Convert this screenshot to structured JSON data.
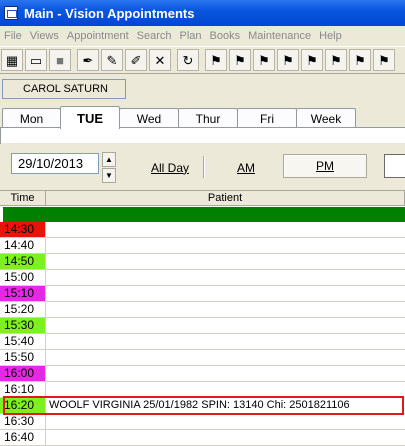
{
  "window": {
    "title": "Main - Vision Appointments"
  },
  "menu": [
    "File",
    "Views",
    "Appointment",
    "Search",
    "Plan",
    "Books",
    "Maintenance",
    "Help"
  ],
  "toolbar": {
    "icons": [
      "calendar-grid-icon",
      "calendar-icon",
      "gray-block-icon",
      "pen-icon",
      "pencil-icon",
      "pencil-x-icon",
      "delete-x-icon",
      "refresh-icon",
      "flag-1-icon",
      "flag-2-icon",
      "flag-3-icon",
      "flag-4-icon",
      "flag-5-icon",
      "flag-6-icon",
      "flag-7-icon",
      "flag-8-icon"
    ]
  },
  "user": {
    "name": "CAROL SATURN"
  },
  "tabs": [
    {
      "label": "Mon"
    },
    {
      "label": "TUE",
      "active": true
    },
    {
      "label": "Wed"
    },
    {
      "label": "Thur"
    },
    {
      "label": "Fri"
    },
    {
      "label": "Week"
    }
  ],
  "controls": {
    "date": "29/10/2013",
    "all_day": "All Day",
    "am": "AM",
    "pm": "PM"
  },
  "grid": {
    "headers": {
      "time": "Time",
      "patient": "Patient"
    },
    "session_bar_color": "#008000",
    "rows": [
      {
        "time": "14:30",
        "color": "#e8140a",
        "patient": ""
      },
      {
        "time": "14:40",
        "color": "",
        "patient": ""
      },
      {
        "time": "14:50",
        "color": "#7ef01e",
        "patient": ""
      },
      {
        "time": "15:00",
        "color": "",
        "patient": ""
      },
      {
        "time": "15:10",
        "color": "#e628e6",
        "patient": ""
      },
      {
        "time": "15:20",
        "color": "",
        "patient": ""
      },
      {
        "time": "15:30",
        "color": "#7ef01e",
        "patient": ""
      },
      {
        "time": "15:40",
        "color": "",
        "patient": ""
      },
      {
        "time": "15:50",
        "color": "",
        "patient": ""
      },
      {
        "time": "16:00",
        "color": "#e628e6",
        "patient": ""
      },
      {
        "time": "16:10",
        "color": "",
        "patient": ""
      },
      {
        "time": "16:20",
        "color": "#7ef01e",
        "patient": "WOOLF VIRGINIA 25/01/1982 SPIN: 13140 Chi: 2501821106",
        "highlighted": true
      },
      {
        "time": "16:30",
        "color": "",
        "patient": ""
      },
      {
        "time": "16:40",
        "color": "",
        "patient": ""
      }
    ]
  }
}
